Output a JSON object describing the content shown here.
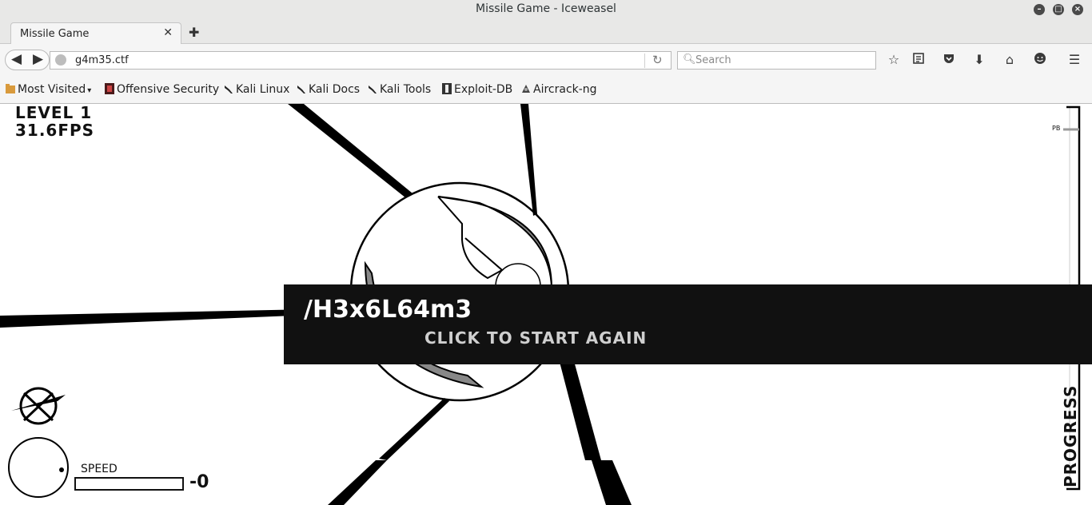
{
  "window": {
    "title": "Missile Game - Iceweasel"
  },
  "tabs": [
    {
      "label": "Missile Game"
    }
  ],
  "navbar": {
    "url": "g4m35.ctf",
    "search_placeholder": "Search"
  },
  "bookmarks": [
    {
      "label": "Most Visited",
      "icon": "folder-icon"
    },
    {
      "label": "Offensive Security",
      "icon": "offsec-icon"
    },
    {
      "label": "Kali Linux",
      "icon": "kali-dragon-icon"
    },
    {
      "label": "Kali Docs",
      "icon": "kali-dragon-icon"
    },
    {
      "label": "Kali Tools",
      "icon": "kali-dragon-icon"
    },
    {
      "label": "Exploit-DB",
      "icon": "exploitdb-icon"
    },
    {
      "label": "Aircrack-ng",
      "icon": "aircrack-icon"
    }
  ],
  "game": {
    "level": "LEVEL 1",
    "fps": "31.6FPS",
    "secret_path": "/H3x6L64m3",
    "restart_prompt": "CLICK TO START AGAIN",
    "speed_label": "SPEED",
    "speed_value": "-0",
    "speed_fraction": 0,
    "progress_label": "PROGRESS",
    "pb_label": "PB"
  },
  "colors": {
    "chrome_bg": "#e8e8e7",
    "toolbar_bg": "#f5f5f5",
    "banner_bg": "#111111",
    "game_ink": "#000000"
  }
}
